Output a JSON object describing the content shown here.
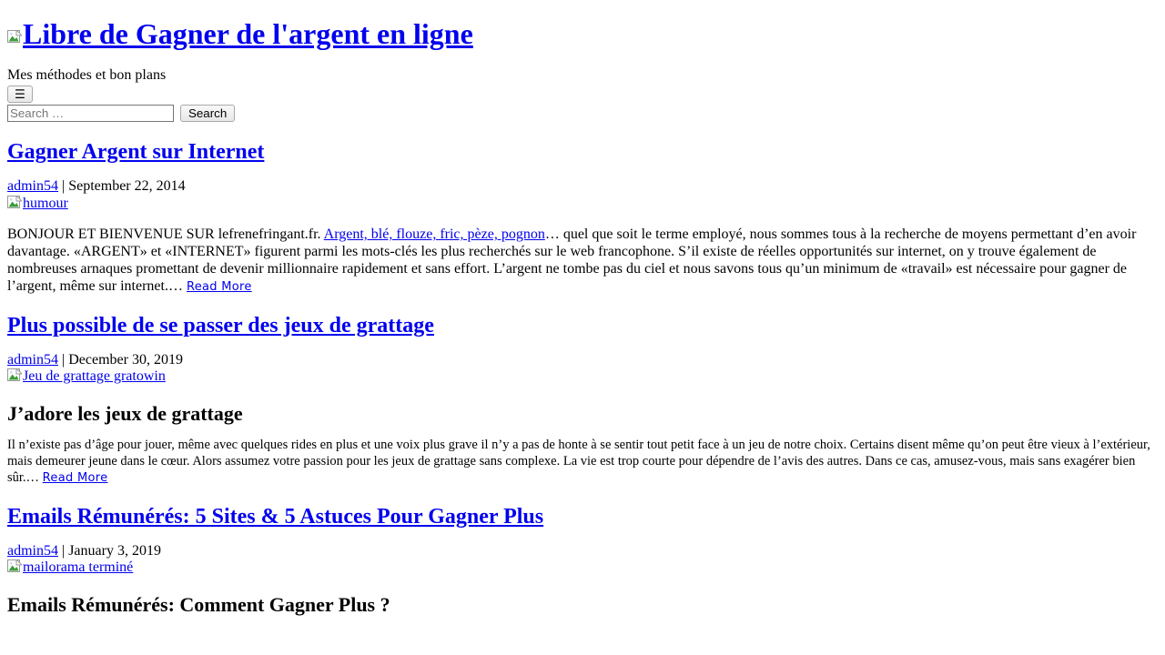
{
  "site": {
    "title": "Libre de Gagner de l'argent en ligne",
    "tagline": "Mes méthodes et bon plans",
    "logo_icon": "broken-image-icon"
  },
  "nav": {
    "menu_toggle_label": "☰",
    "menu_toggle_icon": "hamburger-icon"
  },
  "search": {
    "placeholder": "Search …",
    "value": "",
    "submit_label": "Search"
  },
  "articles": [
    {
      "title": "Gagner Argent sur Internet",
      "author": "admin54",
      "separator": "|",
      "date": "September 22, 2014",
      "thumb_alt": "humour",
      "thumb_icon": "broken-image-icon",
      "subheading": "",
      "excerpt_lead": "BONJOUR ET BIENVENUE SUR lefrenefringant.fr. ",
      "excerpt_link": "Argent, blé, flouze, fric, pèze, pognon",
      "excerpt_rest": "… quel que soit le terme employé, nous sommes tous à la recherche de moyens permettant d’en avoir davantage. «ARGENT» et «INTERNET» figurent parmi les mots-clés les plus recherchés sur le web francophone. S’il existe de réelles opportunités sur internet, on y trouve également de nombreuses arnaques promettant de devenir millionnaire rapidement et sans effort. L’argent ne tombe pas du ciel et nous savons tous qu’un minimum de «travail» est nécessaire pour gagner de l’argent, même sur internet.… ",
      "read_more": "Read More"
    },
    {
      "title": "Plus possible de se passer des jeux de grattage",
      "author": "admin54",
      "separator": "|",
      "date": "December 30, 2019",
      "thumb_alt": "Jeu de grattage gratowin",
      "thumb_icon": "broken-image-icon",
      "subheading": "J’adore les jeux de grattage",
      "excerpt_lead": "",
      "excerpt_link": "",
      "excerpt_rest": "Il n’existe pas d’âge pour jouer, même avec quelques rides en plus et une voix plus grave il n’y a pas de honte à se sentir tout petit face à un jeu de notre choix. Certains disent même qu’on peut être vieux à l’extérieur, mais demeurer jeune dans le cœur. Alors assumez votre passion pour les jeux de grattage sans complexe. La vie est trop courte pour dépendre de l’avis des autres. Dans ce cas, amusez-vous, mais sans exagérer bien sûr.… ",
      "read_more": "Read More"
    },
    {
      "title": "Emails Rémunérés: 5 Sites & 5 Astuces Pour Gagner Plus",
      "author": "admin54",
      "separator": "|",
      "date": "January 3, 2019",
      "thumb_alt": "mailorama terminé",
      "thumb_icon": "broken-image-icon",
      "subheading": "Emails Rémunérés: Comment Gagner Plus ?",
      "excerpt_lead": "",
      "excerpt_link": "",
      "excerpt_rest": "",
      "read_more": ""
    }
  ],
  "colors": {
    "link": "#0000EE",
    "text": "#000000",
    "read_more": "#2222CC",
    "background": "#FFFFFF"
  }
}
